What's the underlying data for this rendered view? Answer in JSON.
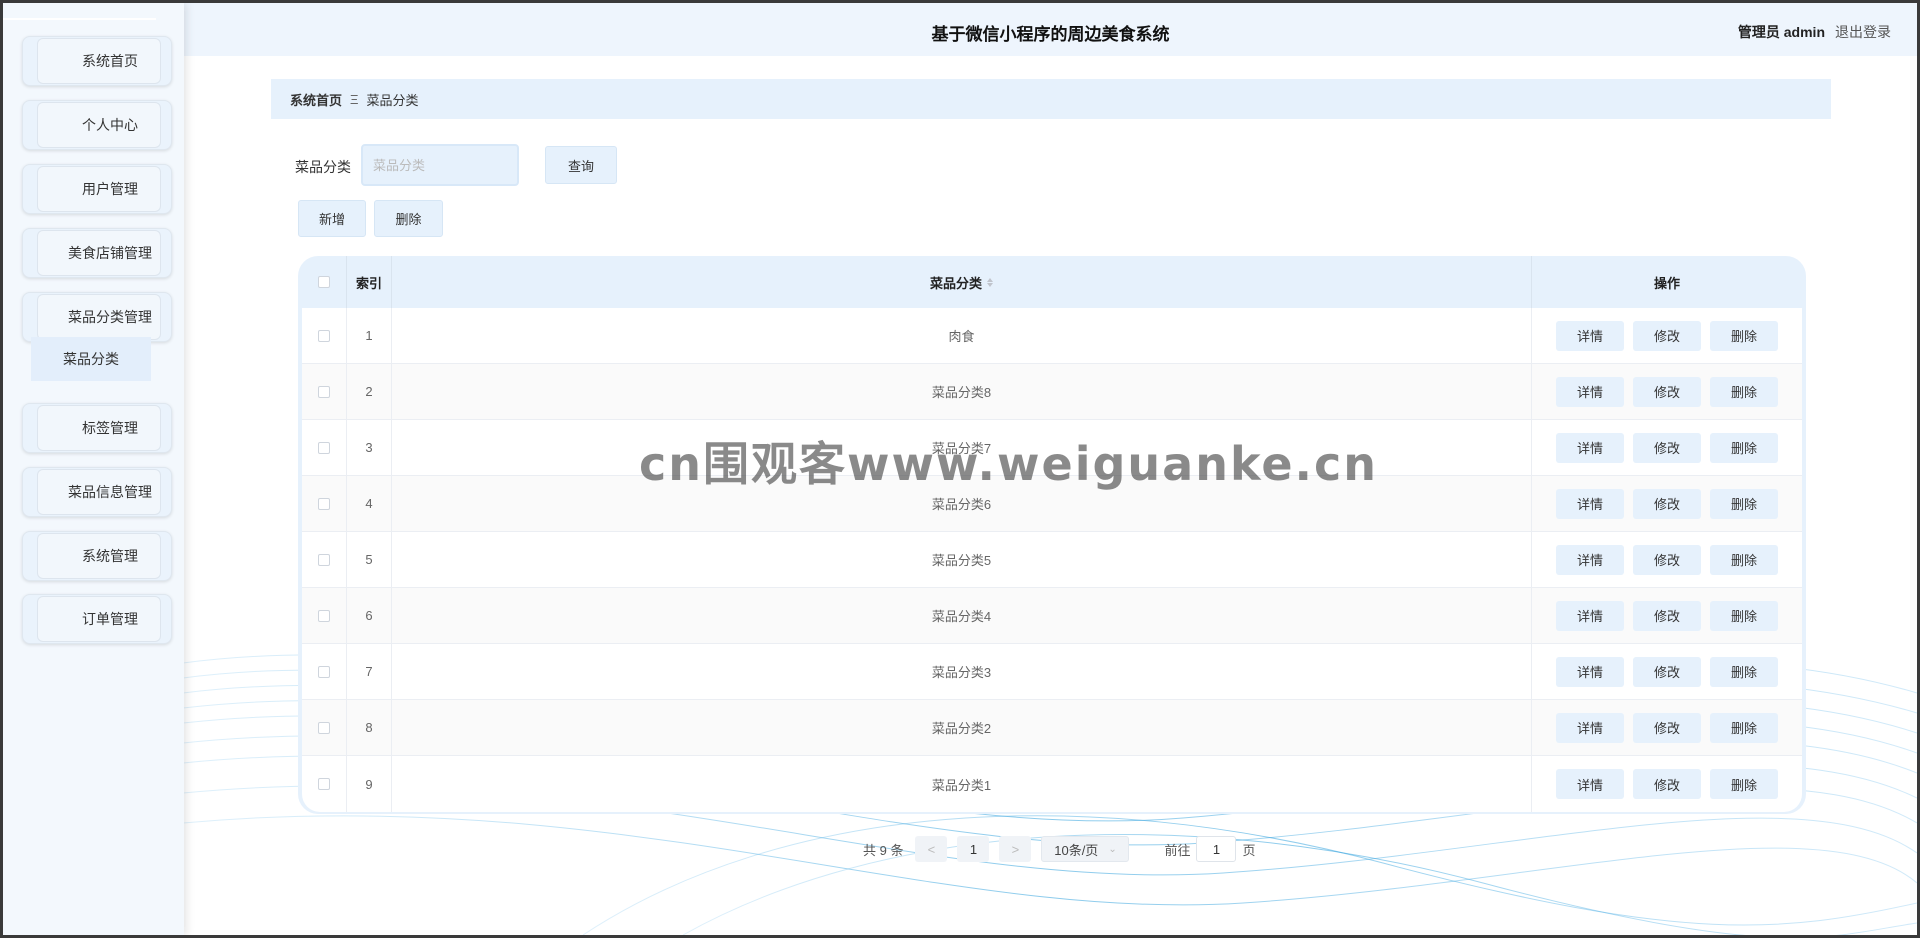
{
  "app": {
    "title": "基于微信小程序的周边美食系统"
  },
  "header": {
    "role": "管理员",
    "username": "admin",
    "logout": "退出登录"
  },
  "sidebar": {
    "items": [
      {
        "label": "系统首页"
      },
      {
        "label": "个人中心"
      },
      {
        "label": "用户管理"
      },
      {
        "label": "美食店铺管理"
      },
      {
        "label": "菜品分类管理"
      },
      {
        "label": "标签管理"
      },
      {
        "label": "菜品信息管理"
      },
      {
        "label": "系统管理"
      },
      {
        "label": "订单管理"
      }
    ],
    "submenu": {
      "label": "菜品分类"
    }
  },
  "breadcrumb": {
    "home": "系统首页",
    "separator": "Ξ",
    "current": "菜品分类"
  },
  "search": {
    "label": "菜品分类",
    "placeholder": "菜品分类",
    "value": "",
    "query_button": "查询"
  },
  "toolbar": {
    "add": "新增",
    "delete": "删除"
  },
  "table": {
    "headers": {
      "index": "索引",
      "name": "菜品分类",
      "ops": "操作"
    },
    "rows": [
      {
        "index": "1",
        "name": "肉食"
      },
      {
        "index": "2",
        "name": "菜品分类8"
      },
      {
        "index": "3",
        "name": "菜品分类7"
      },
      {
        "index": "4",
        "name": "菜品分类6"
      },
      {
        "index": "5",
        "name": "菜品分类5"
      },
      {
        "index": "6",
        "name": "菜品分类4"
      },
      {
        "index": "7",
        "name": "菜品分类3"
      },
      {
        "index": "8",
        "name": "菜品分类2"
      },
      {
        "index": "9",
        "name": "菜品分类1"
      }
    ],
    "ops": {
      "detail": "详情",
      "edit": "修改",
      "delete": "删除"
    }
  },
  "pagination": {
    "total": "共 9 条",
    "prev": "<",
    "page": "1",
    "next": ">",
    "page_size": "10条/页",
    "goto_label": "前往",
    "goto_value": "1",
    "page_suffix": "页"
  },
  "watermark": "cn围观客www.weiguanke.cn",
  "colors": {
    "accent": "#e6f1fc",
    "sidebar": "#f3f8fd",
    "header": "#eef5fd"
  }
}
